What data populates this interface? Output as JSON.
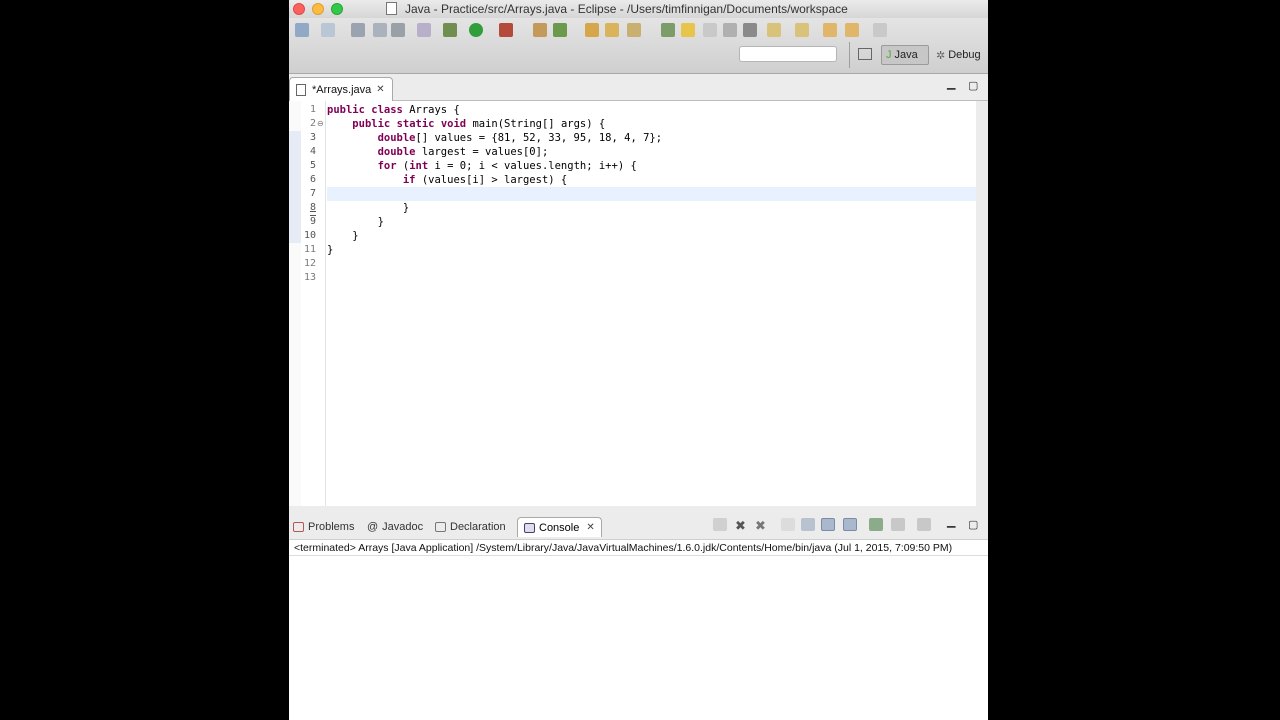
{
  "window": {
    "title": "Java - Practice/src/Arrays.java - Eclipse - /Users/timfinnigan/Documents/workspace"
  },
  "toolbar": {
    "perspectives": [
      {
        "label": "Java",
        "active": true
      },
      {
        "label": "Debug",
        "active": false
      }
    ]
  },
  "editor": {
    "tab_label": "*Arrays.java",
    "line_numbers": [
      "1",
      "2",
      "3",
      "4",
      "5",
      "6",
      "7",
      "8",
      "9",
      "10",
      "11",
      "12",
      "13"
    ],
    "lines": [
      "public class Arrays {",
      "    public static void main(String[] args) {",
      "        double[] values = {81, 52, 33, 95, 18, 4, 7};",
      "        double largest = values[0];",
      "        for (int i = 0; i < values.length; i++) {",
      "            if (values[i] > largest) {",
      "",
      "            }",
      "        }",
      "    }",
      "}",
      "",
      ""
    ],
    "current_line": 7
  },
  "console": {
    "tabs": [
      "Problems",
      "Javadoc",
      "Declaration",
      "Console"
    ],
    "active_tab": "Console",
    "status": "<terminated> Arrays [Java Application] /System/Library/Java/JavaVirtualMachines/1.6.0.jdk/Contents/Home/bin/java (Jul 1, 2015, 7:09:50 PM)"
  },
  "colors": {
    "keyword": "#7f0055",
    "current_line": "#e8f2fe",
    "window_bg": "#ececec"
  }
}
